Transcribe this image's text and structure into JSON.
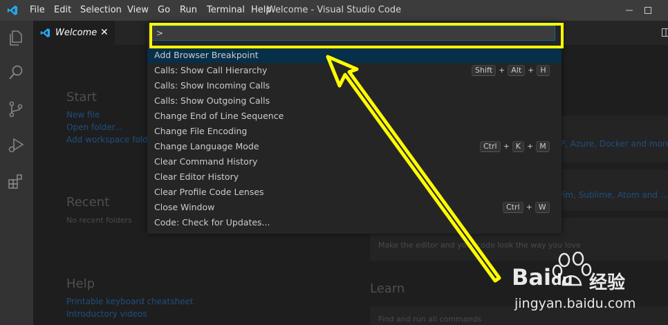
{
  "titlebar": {
    "menus": [
      "File",
      "Edit",
      "Selection",
      "View",
      "Go",
      "Run",
      "Terminal",
      "Help"
    ],
    "title": "Welcome - Visual Studio Code"
  },
  "tab": {
    "label": "Welcome",
    "close": "✕"
  },
  "welcome": {
    "start_heading": "Start",
    "start_links": [
      "New file",
      "Open folder...",
      "Add workspace folder..."
    ],
    "recent_heading": "Recent",
    "recent_text": "No recent folders",
    "help_heading": "Help",
    "help_links": [
      "Printable keyboard cheatsheet",
      "Introductory videos"
    ],
    "right_fragment_1": "P, Azure, Docker and more",
    "right_fragment_2": "/im, Sublime, Atom and ...",
    "theme_text": "Make the editor and your code look the way you love",
    "learn_heading": "Learn",
    "learn_text": "Find and run all commands"
  },
  "palette": {
    "input_value": ">",
    "commands": [
      {
        "label": "Add Browser Breakpoint",
        "keys": []
      },
      {
        "label": "Calls: Show Call Hierarchy",
        "keys": [
          "Shift",
          "Alt",
          "H"
        ]
      },
      {
        "label": "Calls: Show Incoming Calls",
        "keys": []
      },
      {
        "label": "Calls: Show Outgoing Calls",
        "keys": []
      },
      {
        "label": "Change End of Line Sequence",
        "keys": []
      },
      {
        "label": "Change File Encoding",
        "keys": []
      },
      {
        "label": "Change Language Mode",
        "keys": [
          "Ctrl",
          "K",
          "M"
        ]
      },
      {
        "label": "Clear Command History",
        "keys": []
      },
      {
        "label": "Clear Editor History",
        "keys": []
      },
      {
        "label": "Clear Profile Code Lenses",
        "keys": []
      },
      {
        "label": "Close Window",
        "keys": [
          "Ctrl",
          "W"
        ]
      },
      {
        "label": "Code: Check for Updates...",
        "keys": []
      }
    ]
  },
  "watermark": {
    "brand": "Bai",
    "brand2": "du",
    "cn": "经验",
    "url": "jingyan.baidu.com"
  },
  "colors": {
    "highlight": "#ffff00",
    "selection": "#062f4a",
    "accent": "#0e639c"
  },
  "icons": [
    "vscode-logo-icon",
    "explorer-icon",
    "search-icon",
    "source-control-icon",
    "run-debug-icon",
    "extensions-icon",
    "split-editor-icon",
    "arrow-annotation"
  ]
}
